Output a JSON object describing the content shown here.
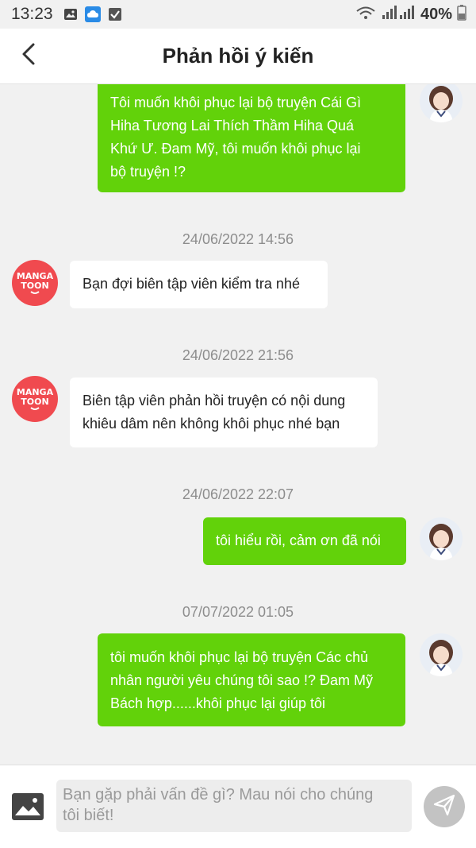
{
  "status_bar": {
    "time": "13:23",
    "battery": "40%",
    "icons": [
      "gallery-icon",
      "cloud-app-icon",
      "checkbox-icon",
      "wifi-icon",
      "signal-icon",
      "battery-icon"
    ]
  },
  "header": {
    "title": "Phản hồi ý kiến",
    "back_icon": "chevron-left-icon"
  },
  "messages": [
    {
      "type": "outgoing",
      "lines": [
        "Tôi muốn khôi phục lại bộ truyện Cái Gì",
        "Hiha Tương Lai Thích Thầm Hiha Quá",
        "Khứ Ư. Đam Mỹ, tôi muốn khôi phục lại",
        "bộ truyện !?"
      ]
    },
    {
      "type": "timestamp",
      "text": "24/06/2022 14:56"
    },
    {
      "type": "incoming",
      "lines": [
        "Bạn đợi biên tập viên kiểm tra nhé"
      ]
    },
    {
      "type": "timestamp",
      "text": "24/06/2022 21:56"
    },
    {
      "type": "incoming",
      "lines": [
        "Biên tập viên phản hồi truyện có nội dung",
        "khiêu dâm nên không khôi phục nhé bạn"
      ]
    },
    {
      "type": "timestamp",
      "text": "24/06/2022 22:07"
    },
    {
      "type": "outgoing",
      "lines": [
        "tôi hiểu rồi, cảm ơn đã nói"
      ]
    },
    {
      "type": "timestamp",
      "text": "07/07/2022 01:05"
    },
    {
      "type": "outgoing",
      "lines": [
        "tôi muốn khôi phục lại bộ truyện Các chủ",
        "nhân người yêu chúng tôi sao !? Đam Mỹ",
        "Bách hợp......khôi phục lại giúp tôi"
      ]
    }
  ],
  "bot_logo": {
    "line1": "MANGA",
    "line2": "TOON"
  },
  "input": {
    "placeholder_line1": "Bạn gặp phải vấn đề gì? Mau nói cho chúng",
    "placeholder_line2": "tôi biết!"
  },
  "colors": {
    "outgoing_bubble": "#62d20a",
    "incoming_bubble": "#ffffff",
    "background": "#f1f1f1",
    "brand_logo": "#f04a4f",
    "send_button": "#c3c3c3"
  }
}
